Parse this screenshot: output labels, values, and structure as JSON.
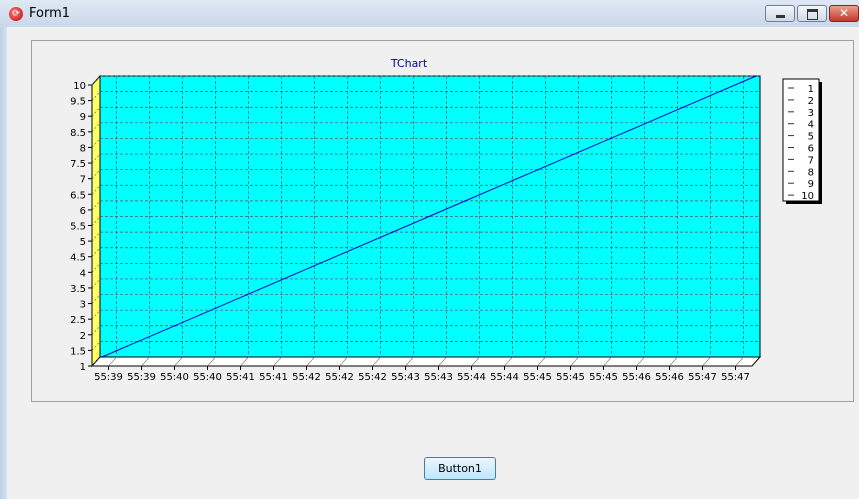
{
  "window": {
    "title": "Form1",
    "icon": "app-icon",
    "controls": [
      "minimize-icon",
      "maximize-icon",
      "close-icon"
    ]
  },
  "button": {
    "label": "Button1"
  },
  "chart_data": {
    "type": "line",
    "title": "TChart",
    "xlabel": "",
    "ylabel": "",
    "x_tick_labels": [
      "55:39",
      "55:39",
      "55:40",
      "55:40",
      "55:41",
      "55:41",
      "55:42",
      "55:42",
      "55:42",
      "55:43",
      "55:43",
      "55:44",
      "55:44",
      "55:45",
      "55:45",
      "55:45",
      "55:46",
      "55:46",
      "55:47",
      "55:47"
    ],
    "y_tick_labels": [
      "1",
      "1.5",
      "2",
      "2.5",
      "3",
      "3.5",
      "4",
      "4.5",
      "5",
      "5.5",
      "6",
      "6.5",
      "7",
      "7.5",
      "8",
      "8.5",
      "9",
      "9.5",
      "10"
    ],
    "ylim": [
      1,
      10
    ],
    "series": [
      {
        "x": [
          1,
          2,
          3,
          4,
          5,
          6,
          7,
          8,
          9,
          10
        ],
        "values": [
          1,
          2,
          3,
          4,
          5,
          6,
          7,
          8,
          9,
          10
        ]
      }
    ],
    "legend": {
      "placement": "right",
      "entries": [
        "1",
        "2",
        "3",
        "4",
        "5",
        "6",
        "7",
        "8",
        "9",
        "10"
      ]
    },
    "grid": true,
    "colors": {
      "plot_bg": "#00ffff",
      "wall": "#ffff66",
      "line": "#0000cc",
      "title": "#0000a0"
    }
  }
}
